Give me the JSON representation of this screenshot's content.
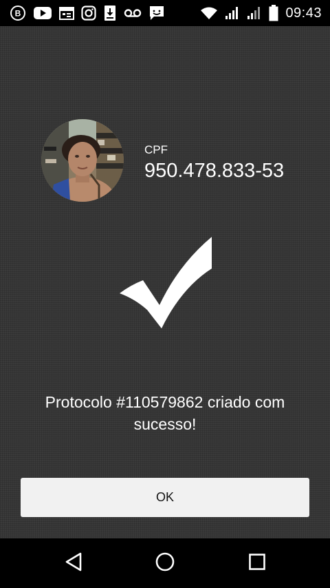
{
  "status_bar": {
    "time": "09:43",
    "left_icons": [
      "b-circle-icon",
      "youtube-icon",
      "calendar-icon",
      "instagram-icon",
      "download-icon",
      "voicemail-icon",
      "message-icon"
    ],
    "right_icons": [
      "wifi-icon",
      "signal-icon",
      "signal-icon",
      "battery-icon"
    ]
  },
  "profile": {
    "cpf_label": "CPF",
    "cpf_value": "950.478.833-53"
  },
  "result": {
    "icon": "checkmark-icon",
    "message": "Protocolo #110579862 criado com sucesso!"
  },
  "actions": {
    "ok_label": "OK"
  },
  "navigation": {
    "icons": [
      "back-icon",
      "home-icon",
      "recents-icon"
    ]
  },
  "colors": {
    "background": "#3a3a3a",
    "bars": "#000000",
    "button": "#f1f1f1",
    "text": "#ffffff"
  }
}
